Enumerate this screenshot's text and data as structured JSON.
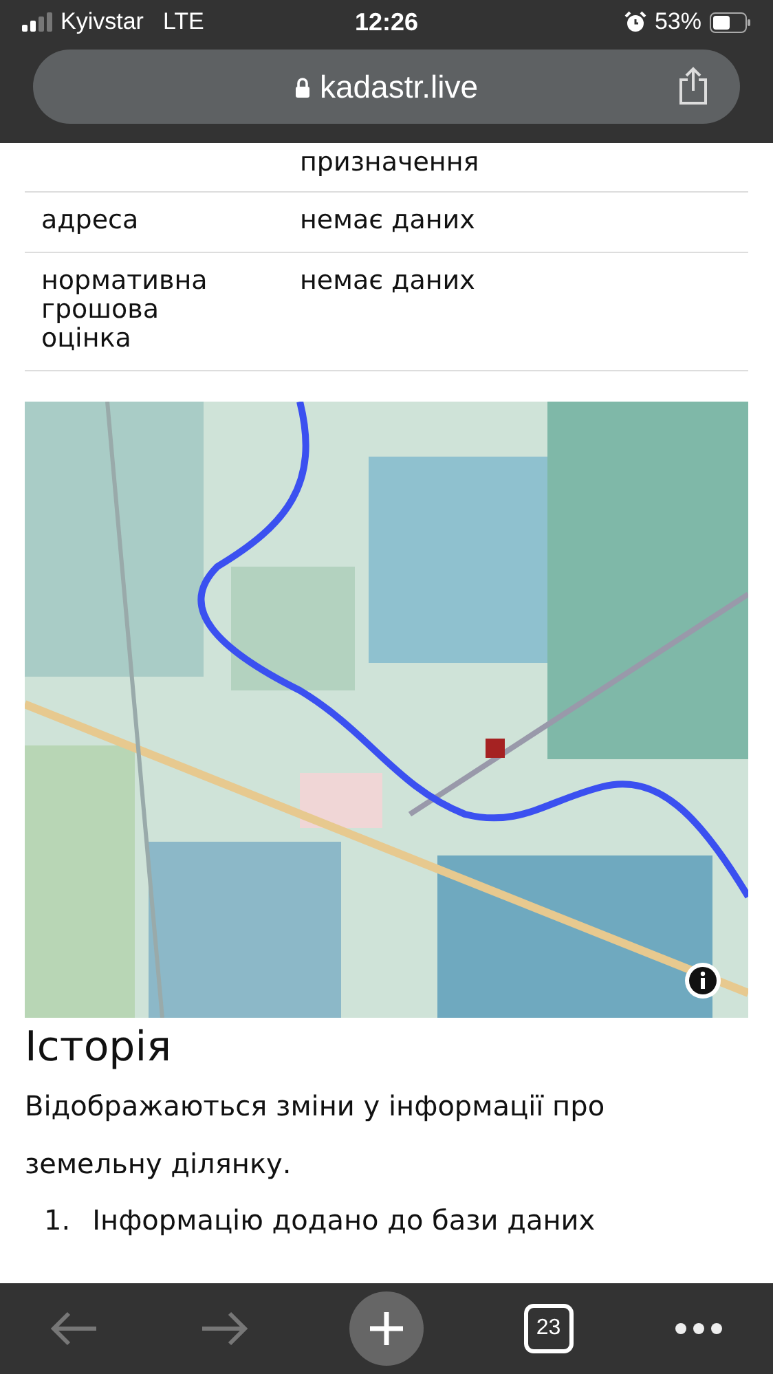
{
  "status_bar": {
    "carrier": "Kyivstar",
    "network": "LTE",
    "time": "12:26",
    "battery": "53%"
  },
  "address_bar": {
    "url": "kadastr.live"
  },
  "table": {
    "rows": [
      {
        "label": "",
        "value": "призначення"
      },
      {
        "label": "адреса",
        "value": "немає даних"
      },
      {
        "label": "нормативна грошова оцінка",
        "value": "немає даних"
      }
    ]
  },
  "history": {
    "title": "Історія",
    "description": "Відображаються зміни у інформації про земельну ділянку.",
    "items": [
      {
        "number": "1.",
        "text": "Інформацію додано до бази даних"
      }
    ]
  },
  "toolbar": {
    "tabs_count": "23"
  }
}
